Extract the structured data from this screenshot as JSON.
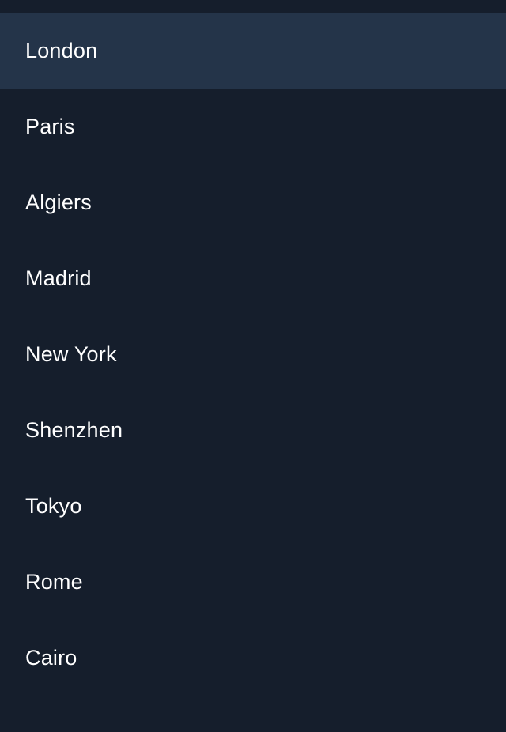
{
  "menu": {
    "items": [
      {
        "label": "London",
        "selected": true
      },
      {
        "label": "Paris",
        "selected": false
      },
      {
        "label": "Algiers",
        "selected": false
      },
      {
        "label": "Madrid",
        "selected": false
      },
      {
        "label": "New York",
        "selected": false
      },
      {
        "label": "Shenzhen",
        "selected": false
      },
      {
        "label": "Tokyo",
        "selected": false
      },
      {
        "label": "Rome",
        "selected": false
      },
      {
        "label": "Cairo",
        "selected": false
      }
    ]
  },
  "colors": {
    "background": "#151e2c",
    "selected_background": "#243449",
    "text": "#ffffff"
  }
}
